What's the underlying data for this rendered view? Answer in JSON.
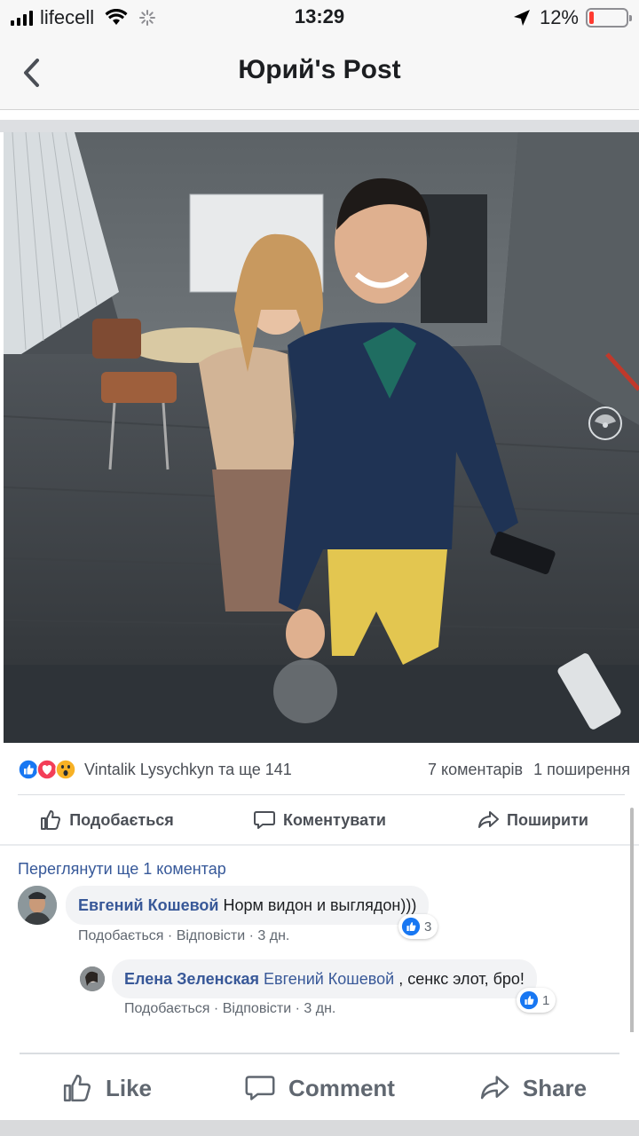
{
  "status_bar": {
    "carrier": "lifecell",
    "time": "13:29",
    "battery": "12%",
    "battery_level": 0.12,
    "battery_color": "#ff3b30"
  },
  "nav": {
    "title": "Юрий's Post"
  },
  "post": {
    "photo_icons": [
      "chevron-left-icon",
      "compass-icon"
    ]
  },
  "reactions": {
    "types": [
      "like",
      "love",
      "wow"
    ],
    "summary": "Vintalik Lysychkyn та ще 141",
    "comments_count": "7 коментарів",
    "shares_count": "1 поширення"
  },
  "actions": {
    "like": "Подобається",
    "comment": "Коментувати",
    "share": "Поширити"
  },
  "comments": {
    "view_more": "Переглянути ще 1 коментар",
    "items": [
      {
        "author": "Евгений Кошевой",
        "text": "Норм видон и выглядон)))",
        "like": "Подобається",
        "reply": "Відповісти",
        "time": "3 дн.",
        "reactions": "3"
      },
      {
        "author": "Елена Зеленская",
        "tag": "Евгений Кошевой",
        "text": ", сенкс элот, бро!",
        "like": "Подобається",
        "reply": "Відповісти",
        "time": "3 дн.",
        "reactions": "1"
      }
    ]
  },
  "bottom_bar": {
    "like": "Like",
    "comment": "Comment",
    "share": "Share"
  },
  "colors": {
    "link": "#385898",
    "like_blue": "#1877f2",
    "love_red": "#f33e58",
    "wow_yellow": "#f7b125"
  }
}
